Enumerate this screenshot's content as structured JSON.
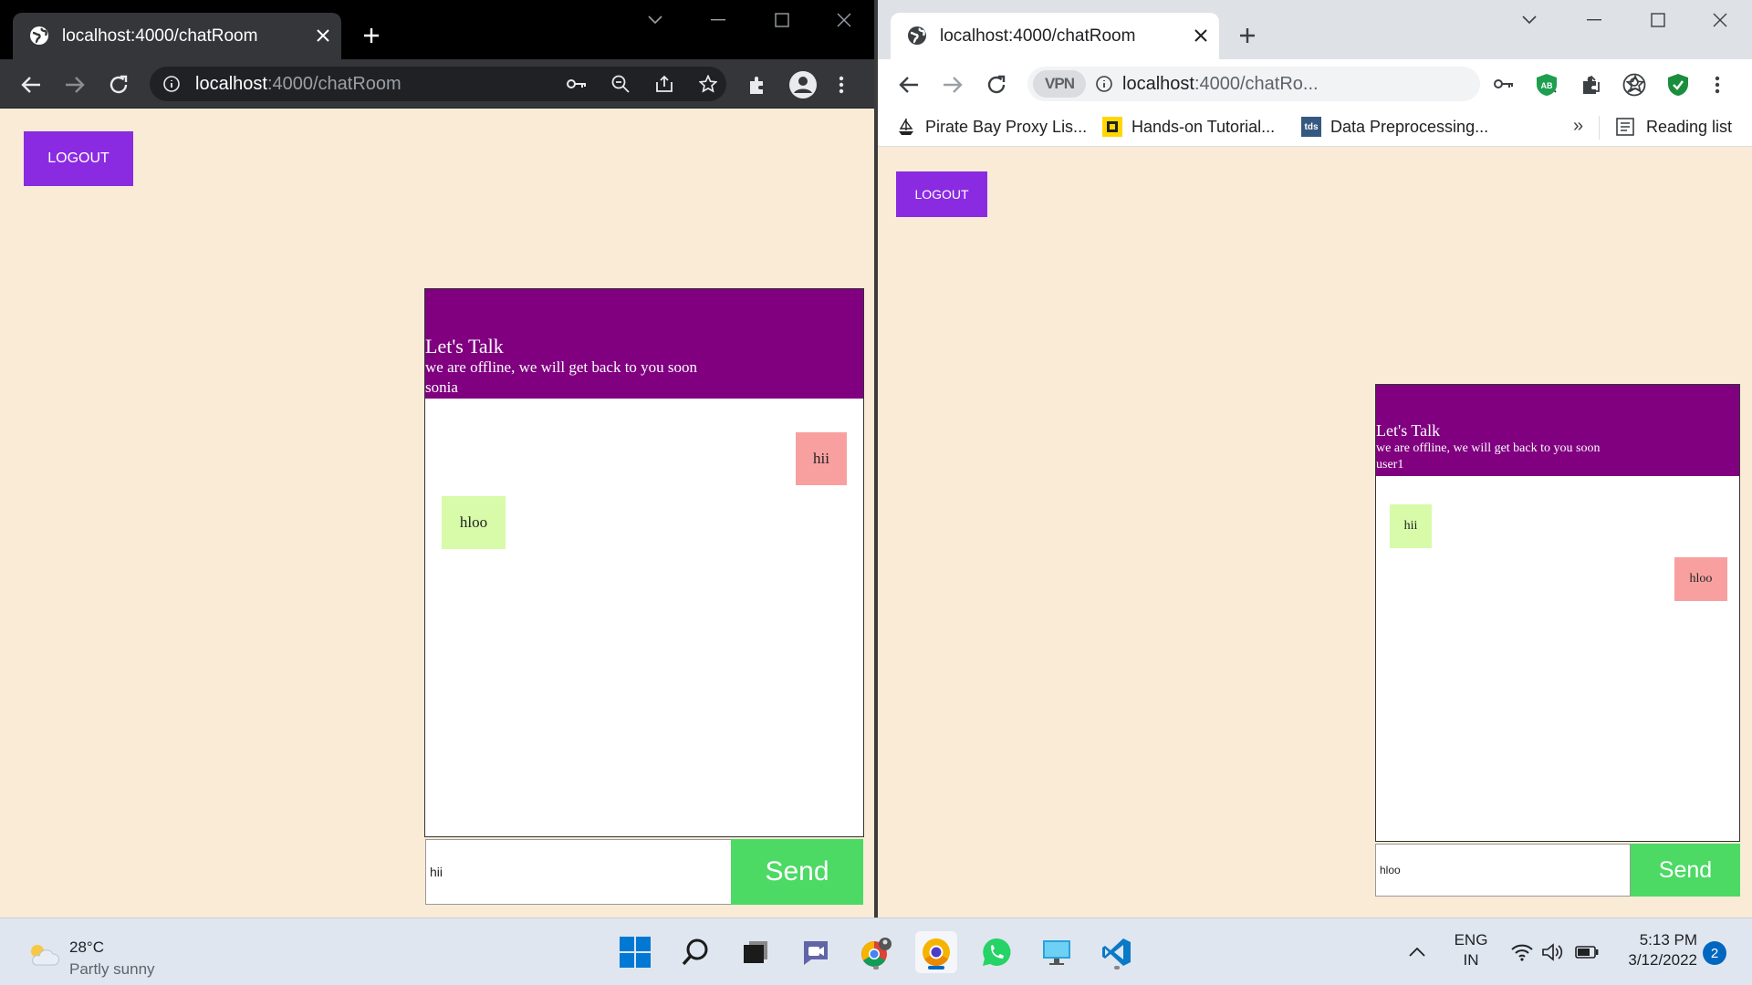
{
  "left_window": {
    "tab_title": "localhost:4000/chatRoom",
    "url_host": "localhost",
    "url_path": ":4000/chatRoom",
    "logout_label": "LOGOUT",
    "chat": {
      "title": "Let's Talk",
      "status": "we are offline, we will get back to you soon",
      "username": "sonia",
      "messages": [
        {
          "text": "hii",
          "direction": "sent"
        },
        {
          "text": "hloo",
          "direction": "received"
        }
      ],
      "input_value": "hii",
      "send_label": "Send"
    }
  },
  "right_window": {
    "tab_title": "localhost:4000/chatRoom",
    "url_host": "localhost",
    "url_path": ":4000/chatRo...",
    "vpn_label": "VPN",
    "bookmarks": [
      {
        "label": "Pirate Bay Proxy Lis...",
        "icon": "ship-icon"
      },
      {
        "label": "Hands-on Tutorial...",
        "icon": "yellow-square-icon"
      },
      {
        "label": "Data Preprocessing...",
        "icon": "tds-icon",
        "icon_text": "tds"
      }
    ],
    "bookmarks_overflow": "»",
    "reading_list_label": "Reading list",
    "logout_label": "LOGOUT",
    "chat": {
      "title": "Let's Talk",
      "status": "we are offline, we will get back to you soon",
      "username": "user1",
      "messages": [
        {
          "text": "hii",
          "direction": "received"
        },
        {
          "text": "hloo",
          "direction": "sent"
        }
      ],
      "input_value": "hloo",
      "send_label": "Send"
    }
  },
  "taskbar": {
    "weather_temp": "28°C",
    "weather_desc": "Partly sunny",
    "language": "ENG",
    "region": "IN",
    "time": "5:13 PM",
    "date": "3/12/2022",
    "notification_count": "2",
    "apps": [
      "start-icon",
      "search-icon",
      "task-view-icon",
      "teams-chat-icon",
      "chrome-profile-icon",
      "chrome-icon",
      "whatsapp-icon",
      "remote-desktop-icon",
      "vscode-icon"
    ]
  },
  "colors": {
    "page_bg": "#faebd7",
    "logout_bg": "#8a2be2",
    "chat_header_bg": "#800080",
    "received_bubble": "#d7fba9",
    "sent_bubble": "#f8a0a0",
    "send_button": "#4cd964"
  }
}
